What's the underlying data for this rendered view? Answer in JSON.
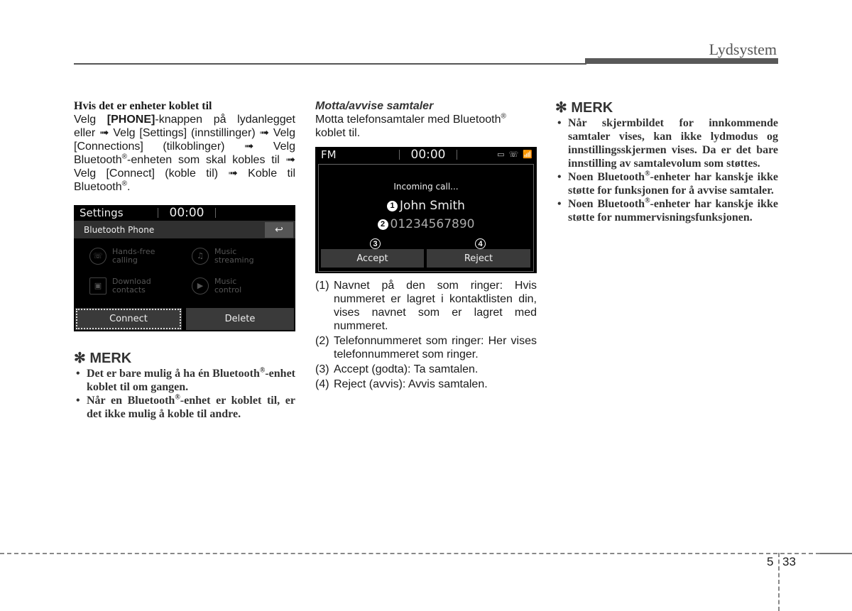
{
  "header": {
    "section_title": "Lydsystem"
  },
  "column1": {
    "subheading": "Hvis det er enheter koblet til",
    "paragraph_parts": [
      "Velg ",
      "[PHONE]",
      "-knappen på lydanlegget eller ➟ Velg [Settings] (innstillinger) ➟ Velg [Connections] (tilkoblinger) ➟ Velg Bluetooth",
      "®",
      "-enheten som skal kobles til ➟ Velg [Connect] (koble til) ➟ Koble til Bluetooth",
      "®",
      "."
    ],
    "screen": {
      "top_left": "Settings",
      "clock": "00:00",
      "subtitle": "Bluetooth Phone",
      "back_icon": "↩",
      "items": [
        {
          "label1": "Hands-free",
          "label2": "calling",
          "icon": "☏"
        },
        {
          "label1": "Music",
          "label2": "streaming",
          "icon": "♫"
        },
        {
          "label1": "Download",
          "label2": "contacts",
          "icon": "▣"
        },
        {
          "label1": "Music",
          "label2": "control",
          "icon": "▶"
        }
      ],
      "buttons": [
        "Connect",
        "Delete"
      ]
    },
    "merk_title": "✻ MERK",
    "merk_items": [
      [
        "Det er bare mulig å ha én Bluetooth",
        "®",
        "-enhet koblet til om gangen."
      ],
      [
        "Når en Bluetooth",
        "®",
        "-enhet er koblet til, er det ikke mulig å koble til andre."
      ]
    ]
  },
  "column2": {
    "subheading": "Motta/avvise samtaler",
    "intro_parts": [
      "Motta telefonsamtaler med Bluetooth",
      "®",
      " koblet til."
    ],
    "screen": {
      "top_left": "FM",
      "clock": "00:00",
      "status_icons": [
        "▭",
        "☏",
        "📶"
      ],
      "incoming": "Incoming call...",
      "caller_name": "John Smith",
      "caller_number": "01234567890",
      "callouts": [
        "1",
        "2",
        "3",
        "4"
      ],
      "buttons": [
        "Accept",
        "Reject"
      ]
    },
    "list": [
      {
        "num": "(1)",
        "text": "Navnet på den som ringer: Hvis nummeret er lagret i kontaktlisten din, vises navnet som er lagret med nummeret."
      },
      {
        "num": "(2)",
        "text": "Telefonnummeret som ringer: Her vises telefonnummeret som ringer."
      },
      {
        "num": "(3)",
        "text": "Accept (godta): Ta samtalen."
      },
      {
        "num": "(4)",
        "text": "Reject (avvis): Avvis samtalen."
      }
    ]
  },
  "column3": {
    "merk_title": "✻ MERK",
    "merk_items": [
      [
        "Når skjermbildet for innkommende samtaler vises, kan ikke lydmodus og innstillingsskjermen vises. Da er det bare innstilling av samtalevolum som støttes.",
        "",
        ""
      ],
      [
        "Noen Bluetooth",
        "®",
        "-enheter har kanskje ikke støtte for funksjonen for å avvise samtaler."
      ],
      [
        "Noen Bluetooth",
        "®",
        "-enheter har kanskje ikke støtte for nummervisningsfunksjonen."
      ]
    ]
  },
  "footer": {
    "chapter": "5",
    "page": "33"
  }
}
